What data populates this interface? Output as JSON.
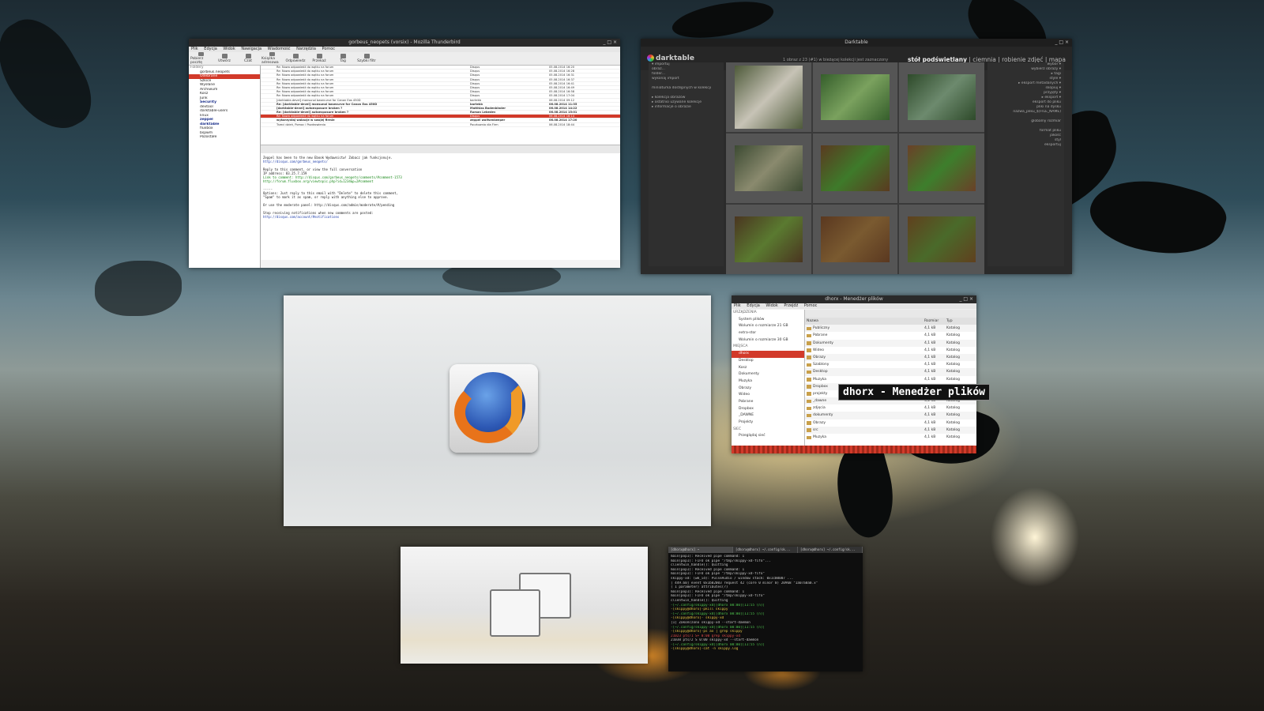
{
  "desktop": {
    "wallpaper": "autumn leaves silhouette at sunset"
  },
  "thunderbird": {
    "title": "gorbeus_neopets (vorsix) - Mozilla Thunderbird",
    "menu": [
      "Plik",
      "Edycja",
      "Widok",
      "Nawigacja",
      "Wiadomość",
      "Narzędzia",
      "Pomoc"
    ],
    "toolbar": [
      "Pobierz pocztę",
      "Utwórz",
      "Czat",
      "Książka adresowa",
      "Odpowiedz",
      "Przekaż",
      "Tag",
      "Szybki filtr"
    ],
    "folder_header": "Foldery",
    "folders": [
      {
        "name": "gorbeus.neopets",
        "sel": false,
        "bold": false
      },
      {
        "name": "Odebrane",
        "sel": true,
        "bold": false
      },
      {
        "name": "Szkice",
        "sel": false,
        "bold": false
      },
      {
        "name": "Wysłane",
        "sel": false,
        "bold": false
      },
      {
        "name": "Archiwum",
        "sel": false,
        "bold": false
      },
      {
        "name": "Kosz",
        "sel": false,
        "bold": false
      },
      {
        "name": "Junk",
        "sel": false,
        "bold": false
      },
      {
        "name": "Security",
        "sel": false,
        "bold": true
      },
      {
        "name": "devtool",
        "sel": false,
        "bold": false
      },
      {
        "name": "darktable-users",
        "sel": false,
        "bold": false
      },
      {
        "name": "linux",
        "sel": false,
        "bold": false
      },
      {
        "name": "zeppel",
        "sel": false,
        "bold": true
      },
      {
        "name": "darktable",
        "sel": false,
        "bold": true
      },
      {
        "name": "fluxbox",
        "sel": false,
        "bold": false
      },
      {
        "name": "bspwm",
        "sel": false,
        "bold": false
      },
      {
        "name": "Pozostałe",
        "sel": false,
        "bold": false
      }
    ],
    "messages": [
      {
        "subject": "Re: Nowa odpowiedź do wątku na forum",
        "from": "Disqus",
        "date": "05.08.2014 16:20",
        "sel": false,
        "bold": false
      },
      {
        "subject": "Re: Nowa odpowiedź do wątku na forum",
        "from": "Disqus",
        "date": "05.08.2014 16:28",
        "sel": false,
        "bold": false
      },
      {
        "subject": "Re: Nowa odpowiedź do wątku na forum",
        "from": "Disqus",
        "date": "05.08.2014 16:31",
        "sel": false,
        "bold": false
      },
      {
        "subject": "Re: Nowa odpowiedź do wątku na forum",
        "from": "Disqus",
        "date": "05.08.2014 16:37",
        "sel": false,
        "bold": false
      },
      {
        "subject": "Re: Nowa odpowiedź do wątku na forum",
        "from": "Disqus",
        "date": "05.08.2014 16:41",
        "sel": false,
        "bold": false
      },
      {
        "subject": "Re: Nowa odpowiedź do wątku na forum",
        "from": "Disqus",
        "date": "05.08.2014 16:49",
        "sel": false,
        "bold": false
      },
      {
        "subject": "Re: Nowa odpowiedź do wątku na forum",
        "from": "Disqus",
        "date": "05.08.2014 16:58",
        "sel": false,
        "bold": false
      },
      {
        "subject": "Re: Nowa odpowiedź do wątku na forum",
        "from": "Disqus",
        "date": "05.08.2014 17:04",
        "sel": false,
        "bold": false
      },
      {
        "subject": "[darktable-devel] monsunol basecurve for Canon Eos 450D",
        "from": "bartekb",
        "date": "06.08.2014 09:12",
        "sel": false,
        "bold": false
      },
      {
        "subject": "Re: [darktable-devel] monsunol basecurve for Canon Eos 450D",
        "from": "bartekb",
        "date": "06.08.2014 11:35",
        "sel": false,
        "bold": true
      },
      {
        "subject": "[darktable-devel] autoexposure broken ?",
        "from": "Matthias Bodenbinder",
        "date": "06.08.2014 14:22",
        "sel": false,
        "bold": true
      },
      {
        "subject": "Re: [darktable-devel] autoexposure broken ?",
        "from": "Roman Lebedev",
        "date": "06.08.2014 15:01",
        "sel": false,
        "bold": true
      },
      {
        "subject": "Re: Nowa odpowiedź do wątku na forum",
        "from": "Disqus",
        "date": "06.08.2014 16:14",
        "sel": true,
        "bold": false
      },
      {
        "subject": "wykorzystaj wakacje w swojej firmie",
        "from": "zeppel wolfsenkeeper",
        "date": "06.08.2014 17:20",
        "sel": false,
        "bold": true
      },
      {
        "subject": "Trzeci dzień, Pomoc i Pozdrowienia",
        "from": "Pocztownia dla Firm",
        "date": "06.08.2014 18:44",
        "sel": false,
        "bold": false
      }
    ],
    "preview": {
      "from": "Disqus <notifications@disqus.net>",
      "lines": [
        {
          "t": "Zeppel has been to the new Ebook Wydawnictw! Zobacz jak funkcjonuje.",
          "c": ""
        },
        {
          "t": "http://disqus.com/gorbeus_neopets/",
          "c": "b"
        },
        {
          "t": "",
          "c": ""
        },
        {
          "t": "Reply to this comment, or view the full conversation",
          "c": ""
        },
        {
          "t": "IP address: 83.25.7.159",
          "c": ""
        },
        {
          "t": "Link to comment: http://disqus.com/gorbeus_neopets/comments/#comment-1573",
          "c": "g"
        },
        {
          "t": "http://forum.fluxbox.org/viewtopic.php?id=1234&p=2#comment",
          "c": "g"
        },
        {
          "t": "",
          "c": ""
        },
        {
          "t": "-----",
          "c": ""
        },
        {
          "t": "Options: Just reply to this email with \"Delete\" to delete this comment,",
          "c": ""
        },
        {
          "t": "\"Spam\" to mark it as spam, or reply with anything else to approve.",
          "c": ""
        },
        {
          "t": "",
          "c": ""
        },
        {
          "t": "Or use the moderate panel: http://disqus.com/admin/moderate/#/pending",
          "c": ""
        },
        {
          "t": "",
          "c": ""
        },
        {
          "t": "Stop receiving notifications when new comments are posted:",
          "c": ""
        },
        {
          "t": "http://disqus.com/account/#notifications",
          "c": "b"
        }
      ]
    }
  },
  "darktable": {
    "title": "Darktable",
    "logo": "darktable",
    "message": "1 obraz z 23 (#1) w bieżącej kolekcji jest zaznaczony",
    "views_active": "stół podświetlany",
    "views_rest": " | ciemnia | robienie zdjęć | mapa",
    "left_panel": [
      "▾ importuj",
      "obraz...",
      "folder...",
      "wykonaj import",
      "",
      "miniaturka dostępnych w kolekcji",
      "",
      "▸ kolekcja obrazów",
      "▸ ostatnio używane kolekcje",
      "▸ informacje o obrazie"
    ],
    "right_panel": [
      "wybór ▾",
      "wybierz obrazy ▾",
      "▸ tagi",
      "style ▾",
      "▸ eksport metadanych ▾",
      "skopiuj ▾",
      "przyjęty ▾",
      "▸ eksport ▾",
      "eksport do pliku",
      "pliki na dysku",
      "nazwa_pliku_$(FILE_NAME)",
      "",
      "globalny rozmiar",
      "",
      "format pliku",
      "jakość",
      "styl",
      "eksportuj"
    ],
    "thumbs": [
      {
        "c1": "#4e5a3a",
        "c2": "#c7c3b6"
      },
      {
        "c1": "#355e2b",
        "c2": "#7aa15e"
      },
      {
        "c1": "#2e4a2a",
        "c2": "#6d8a6e"
      },
      {
        "c1": "#3c4a32",
        "c2": "#8a8a6e"
      },
      {
        "c1": "#5a3a20",
        "c2": "#3e7a2a"
      },
      {
        "c1": "#6a4028",
        "c2": "#3d7e2c"
      },
      {
        "c1": "#4a3520",
        "c2": "#5a7a30"
      },
      {
        "c1": "#5a3820",
        "c2": "#7a5a30"
      },
      {
        "c1": "#60401e",
        "c2": "#4a6a2a"
      }
    ]
  },
  "filemanager": {
    "title": "dhorx - Menedżer plików",
    "menu": [
      "Plik",
      "Edycja",
      "Widok",
      "Przejdź",
      "Pomoc"
    ],
    "location": "dhorx",
    "columns": {
      "name": "Nazwa",
      "size": "Rozmiar",
      "type": "Typ"
    },
    "sidebar": [
      {
        "name": "URZĄDZENIA",
        "sel": false,
        "hd": true
      },
      {
        "name": "System plików",
        "sel": false,
        "hd": false
      },
      {
        "name": "Wolumin o rozmiarze 21 GB",
        "sel": false,
        "hd": false
      },
      {
        "name": "extra-stor",
        "sel": false,
        "hd": false
      },
      {
        "name": "Wolumin o rozmiarze 30 GB",
        "sel": false,
        "hd": false
      },
      {
        "name": "MIEJSCA",
        "sel": false,
        "hd": true
      },
      {
        "name": "dhorx",
        "sel": true,
        "hd": false
      },
      {
        "name": "Desktop",
        "sel": false,
        "hd": false
      },
      {
        "name": "Kosz",
        "sel": false,
        "hd": false
      },
      {
        "name": "Dokumenty",
        "sel": false,
        "hd": false
      },
      {
        "name": "Muzyka",
        "sel": false,
        "hd": false
      },
      {
        "name": "Obrazy",
        "sel": false,
        "hd": false
      },
      {
        "name": "Wideo",
        "sel": false,
        "hd": false
      },
      {
        "name": "Pobrane",
        "sel": false,
        "hd": false
      },
      {
        "name": "Dropbox",
        "sel": false,
        "hd": false
      },
      {
        "name": "_DAWNE",
        "sel": false,
        "hd": false
      },
      {
        "name": "Projekty",
        "sel": false,
        "hd": false
      },
      {
        "name": "SIEĆ",
        "sel": false,
        "hd": true
      },
      {
        "name": "Przeglądaj sieć",
        "sel": false,
        "hd": false
      }
    ],
    "files": [
      {
        "name": "Publiczny",
        "size": "4,1 kB",
        "type": "Katalog"
      },
      {
        "name": "Pobrane",
        "size": "4,1 kB",
        "type": "Katalog"
      },
      {
        "name": "Dokumenty",
        "size": "4,1 kB",
        "type": "Katalog"
      },
      {
        "name": "Wideo",
        "size": "4,1 kB",
        "type": "Katalog"
      },
      {
        "name": "Obrazy",
        "size": "4,1 kB",
        "type": "Katalog"
      },
      {
        "name": "Szablony",
        "size": "4,1 kB",
        "type": "Katalog"
      },
      {
        "name": "Desktop",
        "size": "4,1 kB",
        "type": "Katalog"
      },
      {
        "name": "Muzyka",
        "size": "4,1 kB",
        "type": "Katalog"
      },
      {
        "name": "Dropbox",
        "size": "4,1 kB",
        "type": "Katalog"
      },
      {
        "name": "projekty",
        "size": "4,1 kB",
        "type": "Katalog"
      },
      {
        "name": "_dawne",
        "size": "4,1 kB",
        "type": "Katalog"
      },
      {
        "name": "zdjęcia",
        "size": "4,1 kB",
        "type": "Katalog"
      },
      {
        "name": "dokumenty",
        "size": "4,1 kB",
        "type": "Katalog"
      },
      {
        "name": "Obrazy",
        "size": "4,1 kB",
        "type": "Katalog"
      },
      {
        "name": "src",
        "size": "4,1 kB",
        "type": "Katalog"
      },
      {
        "name": "Muzyka",
        "size": "4,1 kB",
        "type": "Katalog"
      }
    ]
  },
  "terminal": {
    "tabs": [
      "[dhorx@dhorx] ~",
      "[dhorx@dhorx] ~/.config/sk...",
      "[dhorx@dhorx] ~/.config/sk..."
    ],
    "lines": [
      {
        "t": "main(pop1): Received pipe command: 1",
        "c": ""
      },
      {
        "t": "main(pop1): FIFO ok pipe \"/tmp/skippy-xd-fifo\"...",
        "c": ""
      },
      {
        "t": "clientwin_handle(): Quitting",
        "c": ""
      },
      {
        "t": "main(pop1): Received pipe command: 1",
        "c": ""
      },
      {
        "t": "main(pop1): FIFO ok pipe \"/tmp/skippy-xd-fifo\"",
        "c": ""
      },
      {
        "t": "skippy-xd: (wm_id): PulseAudio / window stack: 0x1c00007 ...",
        "c": ""
      },
      {
        "t": "[  449.60]  event 0x1b02003 request 42 (core 0 minor 0) 20968 \"1a07a0a0.x\"",
        "c": ""
      },
      {
        "t": "( 1 parameter) attributes(?)",
        "c": ""
      },
      {
        "t": "main(pop1): Received pipe command: 1",
        "c": ""
      },
      {
        "t": "main(pop1): FIFO ok pipe \"/tmp/skippy-xd-fifo\"",
        "c": ""
      },
      {
        "t": "clientwin_handle(): Quitting",
        "c": ""
      },
      {
        "t": "",
        "c": ""
      },
      {
        "t": "-[~/.config/skippy-xd][dhorx 00:00][11:55 (n)]",
        "c": "g"
      },
      {
        "t": "-[skippy@dhorx]-pkill skippy",
        "c": "y"
      },
      {
        "t": "-[~/.config/skippy-xd][dhorx 00:00][11:55 (n)]",
        "c": "g"
      },
      {
        "t": "-[skippy@dhorx]- skippy-xd",
        "c": "y"
      },
      {
        "t": "[1]   Zakończono        skippy-xd --start-daemon",
        "c": ""
      },
      {
        "t": "-[~/.config/skippy-xd][dhorx 00:00][11:55 (n)]",
        "c": "g"
      },
      {
        "t": "-[skippy@dhorx]-ps ax | grep skippy",
        "c": "y"
      },
      {
        "t": "21023 pts/1    S+     0:00 grep skippy-xd",
        "c": "r"
      },
      {
        "t": "21038 pts/2    S      0:00 skippy-xd --start-daemon",
        "c": ""
      },
      {
        "t": "-[~/.config/skippy-xd][dhorx 00:00][11:55 (n)]",
        "c": "g"
      },
      {
        "t": "-[skippy@dhorx]-cat -n skippy.log",
        "c": "y"
      }
    ]
  }
}
